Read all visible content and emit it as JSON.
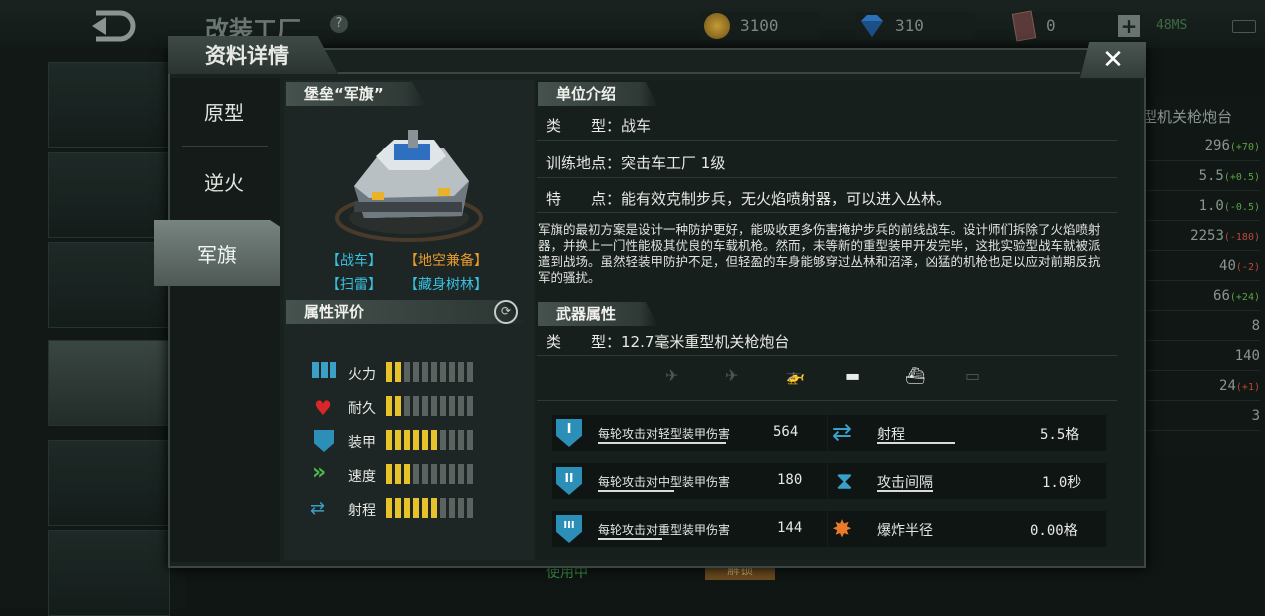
{
  "header": {
    "screen_title": "改装工厂",
    "help_icon": "?",
    "gold": "3100",
    "diamonds": "310",
    "cards": "0",
    "add_label": "+",
    "ping": "48MS"
  },
  "background_right": {
    "title": "型机关枪炮台",
    "rows": [
      {
        "value": "296",
        "delta": "(+70)",
        "delta_type": "g"
      },
      {
        "value": "5.5",
        "delta": "(+0.5)",
        "delta_type": "g"
      },
      {
        "value": "1.0",
        "delta": "(-0.5)",
        "delta_type": "g"
      },
      {
        "value": "2253",
        "delta": "(-180)",
        "delta_type": "r"
      },
      {
        "value": "40",
        "delta": "(-2)",
        "delta_type": "r"
      },
      {
        "value": "66",
        "delta": "(+24)",
        "delta_type": "g"
      },
      {
        "value": "8",
        "delta": "",
        "delta_type": "g"
      },
      {
        "value": "140",
        "delta": "",
        "delta_type": "g"
      },
      {
        "value": "24",
        "delta": "(+1)",
        "delta_type": "r"
      },
      {
        "value": "3",
        "delta": "",
        "delta_type": "g"
      }
    ]
  },
  "background_bottom": {
    "in_use": "使用中",
    "unlock": "解锁"
  },
  "dialog": {
    "title": "资料详情",
    "close_label": "✕",
    "nav": [
      {
        "label": "原型"
      },
      {
        "label": "逆火"
      },
      {
        "label": "军旗"
      }
    ],
    "unit_name": "堡垒“军旗”",
    "tags": [
      "【战车】",
      "【地空兼备】",
      "【扫雷】",
      "【藏身树林】"
    ],
    "attr_title": "属性评价",
    "stats": [
      {
        "label": "火力",
        "level": 2,
        "max": 10
      },
      {
        "label": "耐久",
        "level": 2,
        "max": 10
      },
      {
        "label": "装甲",
        "level": 6,
        "max": 10
      },
      {
        "label": "速度",
        "level": 3,
        "max": 10
      },
      {
        "label": "射程",
        "level": 6,
        "max": 10
      }
    ],
    "intro_title": "单位介绍",
    "type_label": "类　　型：",
    "type_value": "战车",
    "train_label": "训练地点：",
    "train_value": "突击车工厂 1级",
    "feature_label": "特　　点：",
    "feature_value": "能有效克制步兵，无火焰喷射器，可以进入丛林。",
    "description": "军旗的最初方案是设计一种防护更好，能吸收更多伤害掩护步兵的前线战车。设计师们拆除了火焰喷射器，并换上一门性能极其优良的车载机枪。然而，未等新的重型装甲开发完毕，这批实验型战车就被派遣到战场。虽然轻装甲防护不足，但轻盈的车身能够穿过丛林和沼泽，凶猛的机枪也足以应对前期反抗军的骚扰。",
    "weapon_title": "武器属性",
    "weapon_type_label": "类　　型：",
    "weapon_type_value": "12.7毫米重型机关枪炮台",
    "targets": [
      {
        "icon": "fighter-jet-icon",
        "glyph": "✈",
        "on": false
      },
      {
        "icon": "bomber-icon",
        "glyph": "✈",
        "on": false
      },
      {
        "icon": "helicopter-icon",
        "glyph": "🚁",
        "on": true
      },
      {
        "icon": "tank-icon",
        "glyph": "▬",
        "on": true
      },
      {
        "icon": "ship-icon",
        "glyph": "⛴",
        "on": true
      },
      {
        "icon": "submarine-icon",
        "glyph": "▭",
        "on": false
      }
    ],
    "weapon_stats_left": [
      {
        "name": "每轮攻击对轻型装甲伤害",
        "value": "564",
        "icon": "light-armor-icon",
        "numeral": "I"
      },
      {
        "name": "每轮攻击对中型装甲伤害",
        "value": "180",
        "icon": "medium-armor-icon",
        "numeral": "II"
      },
      {
        "name": "每轮攻击对重型装甲伤害",
        "value": "144",
        "icon": "heavy-armor-icon",
        "numeral": "III"
      }
    ],
    "weapon_stats_right": [
      {
        "name": "射程",
        "value": "5.5格",
        "icon": "range-icon"
      },
      {
        "name": "攻击间隔",
        "value": "1.0秒",
        "icon": "hourglass-icon"
      },
      {
        "name": "爆炸半径",
        "value": "0.00格",
        "icon": "explosion-icon"
      }
    ],
    "colors": {
      "accent_yellow": "#e8c22a",
      "tag_orange": "#e89a2a",
      "tag_cyan": "#38c0e0"
    }
  }
}
